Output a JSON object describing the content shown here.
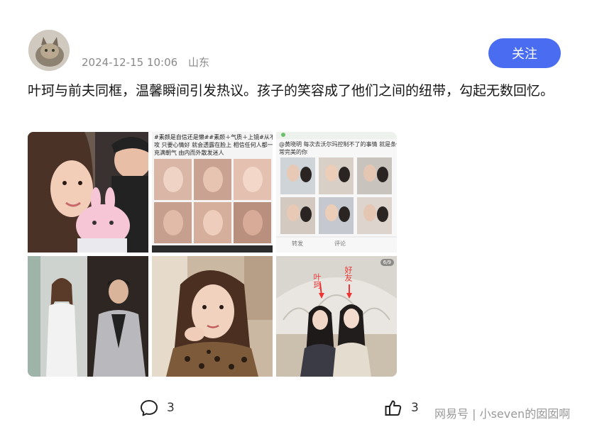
{
  "post": {
    "date": "2024-12-15 10:06",
    "location": "山东",
    "follow_label": "关注",
    "text": "叶珂与前夫同框，温馨瞬间引发热议。孩子的笑容成了他们之间的纽带，勾起无数回忆。"
  },
  "images": [
    {
      "id": "photo-1"
    },
    {
      "id": "photo-2",
      "caption_1": "#素颜是自信还是懒##素颜＋气质＋上镜#从不",
      "caption_2": "攻 只要心情好 就会透露在脸上 相信任何人都一",
      "caption_3": "充满朝气 由内而外散发迷人"
    },
    {
      "id": "photo-3",
      "caption_1": "@黄晓明 每次去沃尔玛控制不了的事情 就是条你",
      "caption_2": "常完美的你",
      "bar_1": "转发",
      "bar_2": "评论"
    },
    {
      "id": "photo-4"
    },
    {
      "id": "photo-5"
    },
    {
      "id": "photo-6",
      "arrow_label_1": "叶珂",
      "arrow_label_2": "好友",
      "counter": "6/9"
    }
  ],
  "actions": {
    "comment_icon": "comment-icon",
    "comment_count": "3",
    "like_icon": "thumbs-up-icon",
    "like_count": "3"
  },
  "watermark": "网易号 | 小seven的囡囡啊"
}
